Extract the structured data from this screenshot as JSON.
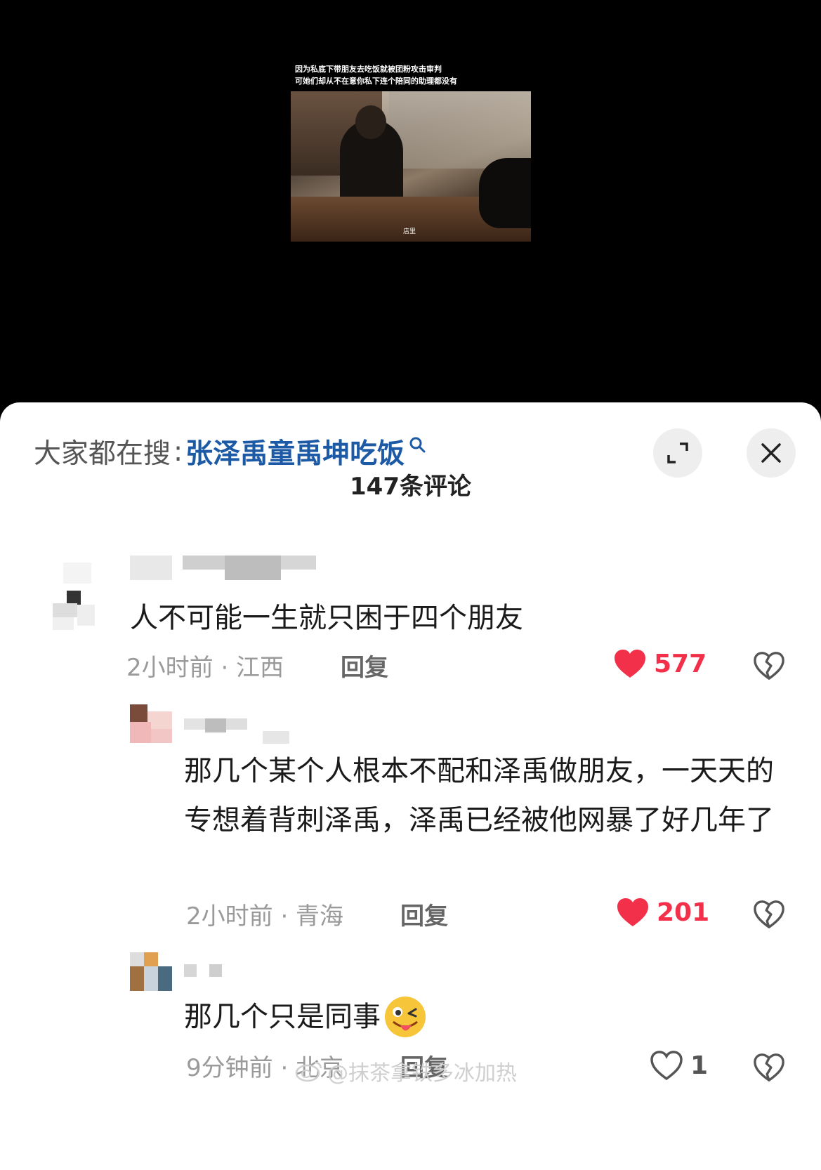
{
  "video": {
    "caption_line1": "因为私底下带朋友去吃饭就被团粉攻击审判",
    "caption_line2": "可她们却从不在意你私下连个陪同的助理都没有",
    "subtitle": "店里"
  },
  "search_bar": {
    "prefix": "大家都在搜",
    "colon": ":",
    "term": "张泽禹童禹坤吃饭"
  },
  "comment_count": "147条评论",
  "comments": [
    {
      "text": "人不可能一生就只困于四个朋友",
      "meta": "2小时前 · 江西",
      "reply": "回复",
      "likes": "577",
      "liked": true
    },
    {
      "text": "那几个某个人根本不配和泽禹做朋友，一天天的专想着背刺泽禹，泽禹已经被他网暴了好几年了",
      "meta": "2小时前 · 青海",
      "reply": "回复",
      "likes": "201",
      "liked": true
    },
    {
      "text": "那几个只是同事",
      "meta": "9分钟前 · 北京",
      "reply": "回复",
      "likes": "1",
      "liked": false
    }
  ],
  "watermark": "@抹茶拿铁多冰加热",
  "colors": {
    "accent_blue": "#1d5aa6",
    "like_red": "#f2304a",
    "meta_gray": "#9a9a9a"
  }
}
